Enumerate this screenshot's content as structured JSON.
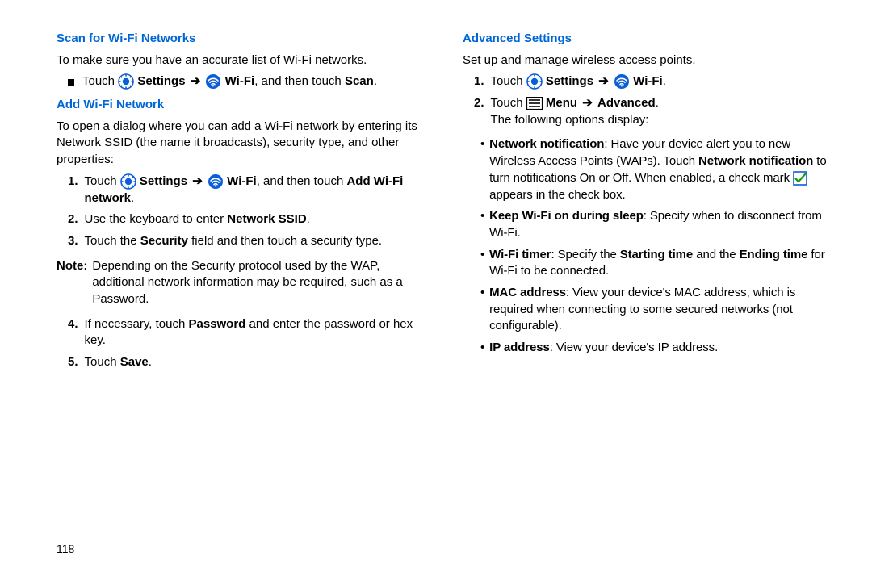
{
  "page_number": "118",
  "icons": {
    "arrow": "➔"
  },
  "left": {
    "sec1": {
      "title": "Scan for Wi-Fi Networks",
      "lead": "To make sure you have an accurate list of Wi-Fi networks.",
      "bullet": {
        "pre": "Touch ",
        "settings": "Settings",
        "wifi": "Wi-Fi",
        "post1": ", and then touch ",
        "scan": "Scan",
        "end": "."
      }
    },
    "sec2": {
      "title": "Add Wi-Fi Network",
      "lead": "To open a dialog where you can add a Wi-Fi network by entering its Network SSID (the name it broadcasts), security type, and other properties:",
      "step1": {
        "n": "1.",
        "pre": "Touch ",
        "settings": "Settings",
        "wifi": "Wi-Fi",
        "post1": ", and then touch ",
        "add": "Add Wi-Fi network",
        "end": "."
      },
      "step2": {
        "n": "2.",
        "pre": "Use the keyboard to enter ",
        "b": "Network SSID",
        "end": "."
      },
      "step3": {
        "n": "3.",
        "pre": "Touch the ",
        "b": "Security",
        "post": " field and then touch a security type."
      },
      "note": {
        "label": "Note:",
        "text": "Depending on the Security protocol used by the WAP, additional network information may be required, such as a Password."
      },
      "step4": {
        "n": "4.",
        "pre": "If necessary, touch ",
        "b": "Password",
        "post": " and enter the password or hex key."
      },
      "step5": {
        "n": "5.",
        "pre": "Touch ",
        "b": "Save",
        "end": "."
      }
    }
  },
  "right": {
    "title": "Advanced Settings",
    "lead": "Set up and manage wireless access points.",
    "step1": {
      "n": "1.",
      "pre": "Touch ",
      "settings": "Settings",
      "wifi": "Wi-Fi",
      "end": "."
    },
    "step2": {
      "n": "2.",
      "pre": "Touch ",
      "menu": "Menu",
      "adv": "Advanced",
      "end": ".",
      "trail": "The following options display:"
    },
    "bullets": {
      "b1": {
        "t1": "Network notification",
        "t2": ": Have your device alert you to new Wireless Access Points (WAPs). Touch ",
        "t3": "Network notification",
        "t4": " to turn notifications On or Off. When enabled, a check mark ",
        "t5": " appears in the check box."
      },
      "b2": {
        "t1": "Keep Wi-Fi on during sleep",
        "t2": ": Specify when to disconnect from Wi-Fi."
      },
      "b3": {
        "t1": "Wi-Fi timer",
        "t2": ": Specify the ",
        "t3": "Starting time",
        "t4": " and the ",
        "t5": "Ending time",
        "t6": " for Wi-Fi to be connected."
      },
      "b4": {
        "t1": "MAC address",
        "t2": ": View your device's MAC address, which is required when connecting to some secured networks (not configurable)."
      },
      "b5": {
        "t1": "IP address",
        "t2": ": View your device's IP address."
      }
    }
  }
}
